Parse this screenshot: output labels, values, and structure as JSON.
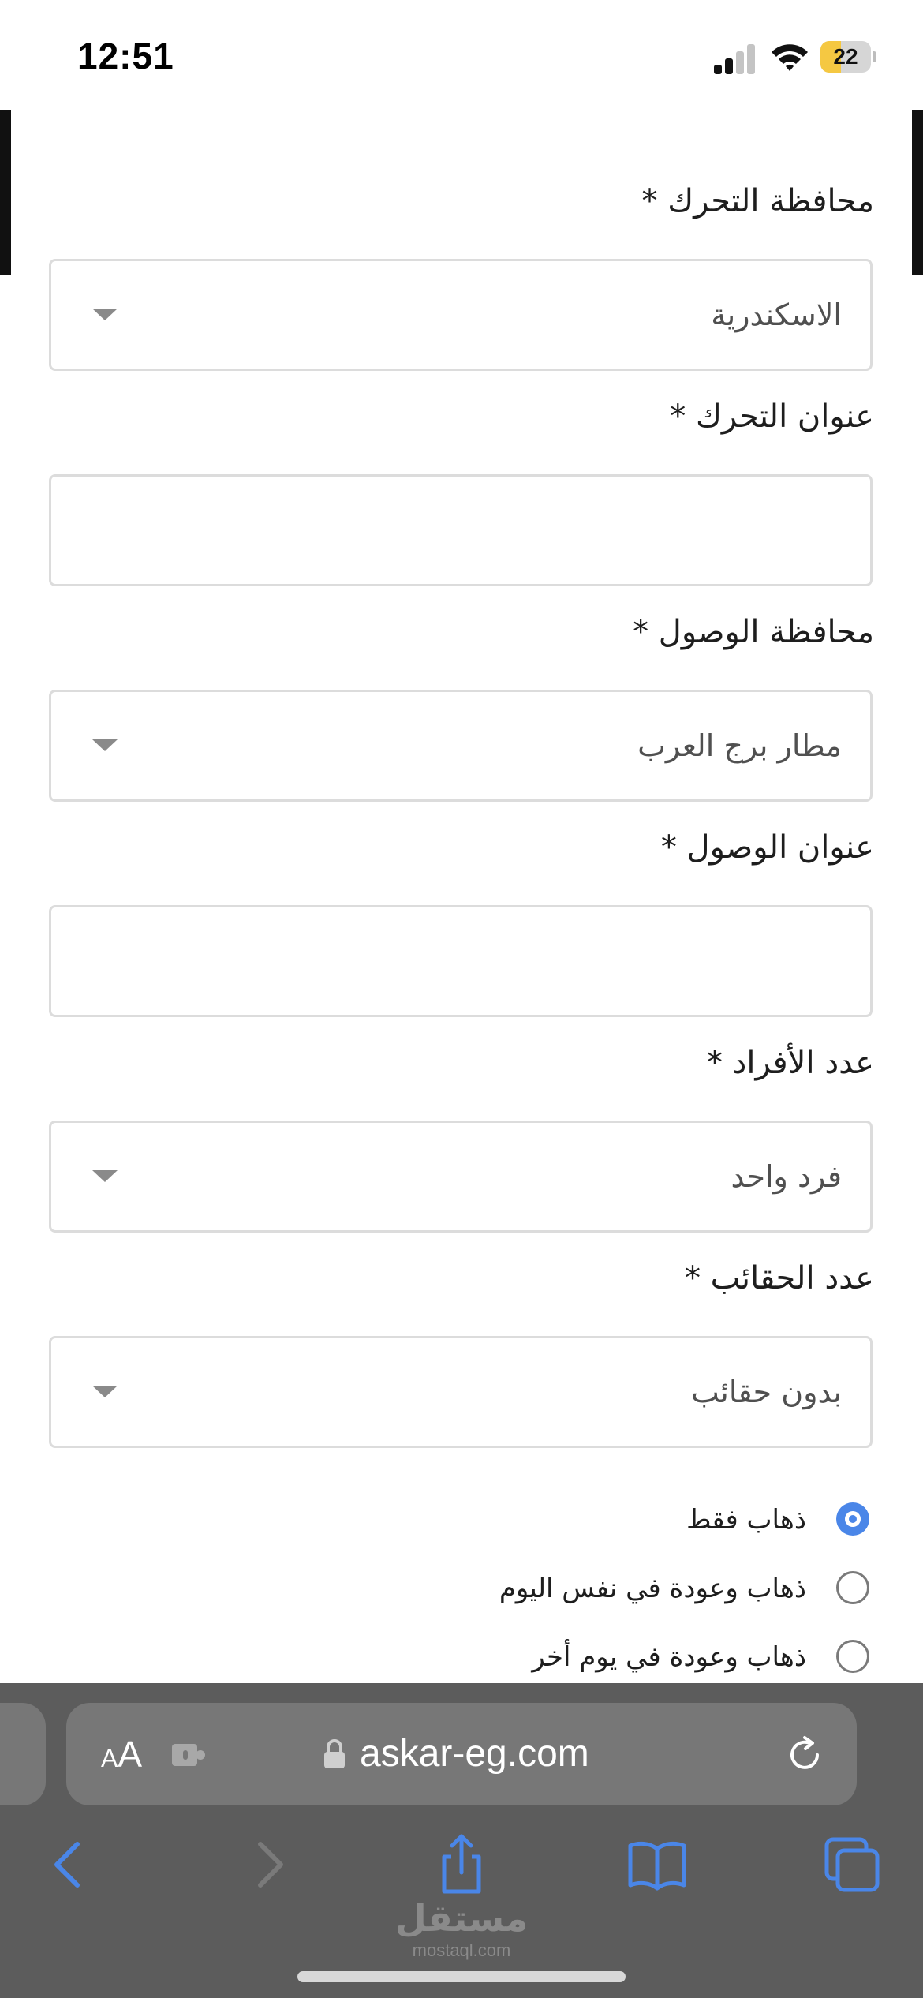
{
  "status_bar": {
    "time": "12:51",
    "battery_level": "22",
    "icons": [
      "cellular-signal-icon",
      "wifi-icon",
      "battery-icon"
    ]
  },
  "form": {
    "departure_governorate": {
      "label": "محافظة التحرك *",
      "value": "الاسكندرية"
    },
    "departure_address": {
      "label": "عنوان التحرك *",
      "value": ""
    },
    "arrival_governorate": {
      "label": "محافظة الوصول *",
      "value": "مطار برج العرب"
    },
    "arrival_address": {
      "label": "عنوان الوصول *",
      "value": ""
    },
    "passengers": {
      "label": "عدد الأفراد *",
      "value": "فرد واحد"
    },
    "bags": {
      "label": "عدد الحقائب *",
      "value": "بدون حقائب"
    },
    "trip_type": {
      "options": [
        {
          "label": "ذهاب فقط",
          "checked": true
        },
        {
          "label": "ذهاب وعودة في نفس اليوم",
          "checked": false
        },
        {
          "label": "ذهاب وعودة في يوم أخر",
          "checked": false
        }
      ]
    }
  },
  "browser": {
    "text_size_small": "A",
    "text_size_big": "A",
    "url": "askar-eg.com",
    "toolbar": [
      "back-icon",
      "forward-icon",
      "share-icon",
      "bookmarks-icon",
      "tabs-icon"
    ]
  },
  "watermark": {
    "arabic": "مستقل",
    "latin": "mostaql.com"
  },
  "colors": {
    "accent_blue": "#4a86e8",
    "battery_yellow": "#f5c842",
    "browser_bg": "#5c5c5c",
    "address_bar_bg": "#777777",
    "field_border": "#dcdcdc"
  }
}
